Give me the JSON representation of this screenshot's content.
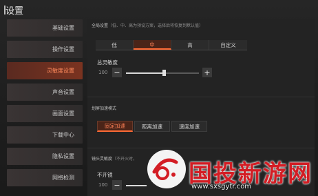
{
  "window": {
    "title": "设置"
  },
  "sidebar": {
    "items": [
      {
        "label": "基础设置",
        "active": false
      },
      {
        "label": "操作设置",
        "active": false
      },
      {
        "label": "灵敏度设置",
        "active": true
      },
      {
        "label": "声音设置",
        "active": false
      },
      {
        "label": "画面设置",
        "active": false
      },
      {
        "label": "下载中心",
        "active": false
      },
      {
        "label": "隐私设置",
        "active": false
      },
      {
        "label": "网络检测",
        "active": false
      }
    ]
  },
  "global": {
    "label": "全局设置",
    "hint": "（低、中、高为预设方案，选择后将恢复到默认值）",
    "options": [
      "低",
      "中",
      "高",
      "自定义"
    ],
    "selected": "中"
  },
  "sensitivity": {
    "label": "总灵敏度",
    "value": "100",
    "minus": "−",
    "plus": "+",
    "level": 0.52
  },
  "acceleration": {
    "label": "划屏加速模式",
    "options": [
      "固定加速",
      "距离加速",
      "速度加速"
    ],
    "selected": "固定加速"
  },
  "camera": {
    "label": "镜头灵敏度",
    "hint": "（不开火时，",
    "sub_label": "不开镜",
    "value": "100",
    "minus": "−"
  },
  "watermark": {
    "text": "国投新游网",
    "url": "www.sxsgytr.com"
  },
  "colors": {
    "accent": "#ff6b35",
    "active_bg": "#4a2418",
    "watermark_red": "#d31d24"
  }
}
